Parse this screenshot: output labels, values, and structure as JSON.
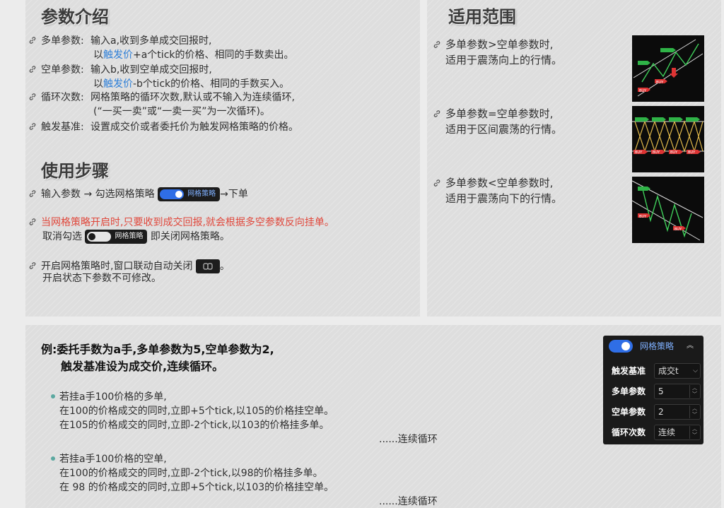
{
  "params": {
    "title": "参数介绍",
    "long": {
      "label": "多单参数:",
      "line1": "输入a,收到多单成交回报时,",
      "line2_pre": "以",
      "line2_link": "触发价",
      "line2_post": "+a个tick的价格、相同的手数卖出。"
    },
    "short": {
      "label": "空单参数:",
      "line1": "输入b,收到空单成交回报时,",
      "line2_pre": "以",
      "line2_link": "触发价",
      "line2_post": "-b个tick的价格、相同的手数买入。"
    },
    "loop": {
      "label": "循环次数:",
      "line1": "网格策略的循环次数,默认或不输入为连续循环,",
      "line2": "(“一买一卖”或“一卖一买”为一次循环)。"
    },
    "trigger": {
      "label": "触发基准:",
      "line1": "设置成交价或者委托价为触发网格策略的价格。"
    }
  },
  "steps": {
    "title": "使用步骤",
    "step1_pre": "输入参数 → 勾选网格策略",
    "step1_post": "→下单",
    "toggle_label": "网格策略",
    "warning": "当网格策略开启时,只要收到成交回报,就会根据多空参数反向挂单。",
    "cancel_pre": "取消勾选",
    "cancel_post": "即关闭网格策略。",
    "window_pre": "开启网格策略时,窗口联动自动关闭",
    "window_post": "。",
    "window_line2": "开启状态下参数不可修改。"
  },
  "scope": {
    "title": "适用范围",
    "items": [
      {
        "line1": "多单参数>空单参数时,",
        "line2": "适用于震荡向上的行情。"
      },
      {
        "line1": "多单参数=空单参数时,",
        "line2": "适用于区间震荡的行情。"
      },
      {
        "line1": "多单参数<空单参数时,",
        "line2": "适用于震荡向下的行情。"
      }
    ],
    "chart_labels": {
      "buy": "BUY",
      "sell": "SELL"
    }
  },
  "example": {
    "title_line1": "例:委托手数为a手,多单参数为5,空单参数为2,",
    "title_line2": "触发基准设为成交价,连续循环。",
    "case1": {
      "line1": "若挂a手100价格的多单,",
      "line2": "在100的价格成交的同时,立即+5个tick,以105的价格挂空单。",
      "line3": "在105的价格成交的同时,立即-2个tick,以103的价格挂多单。",
      "end": "......连续循环"
    },
    "case2": {
      "line1": "若挂a手100价格的空单,",
      "line2": "在100的价格成交的同时,立即-2个tick,以98的价格挂多单。",
      "line3": "在 98 的价格成交的同时,立即+5个tick,以103的价格挂空单。",
      "end": "......连续循环"
    }
  },
  "strategy_panel": {
    "title": "网格策略",
    "rows": [
      {
        "label": "触发基准",
        "value": "成交t"
      },
      {
        "label": "多单参数",
        "value": "5"
      },
      {
        "label": "空单参数",
        "value": "2"
      },
      {
        "label": "循环次数",
        "value": "连续"
      }
    ]
  },
  "colors": {
    "accent_blue": "#2d7fd8",
    "warning_red": "#e0483c",
    "toggle_on": "#2f6ee6",
    "bullet": "#5ba8a0"
  }
}
